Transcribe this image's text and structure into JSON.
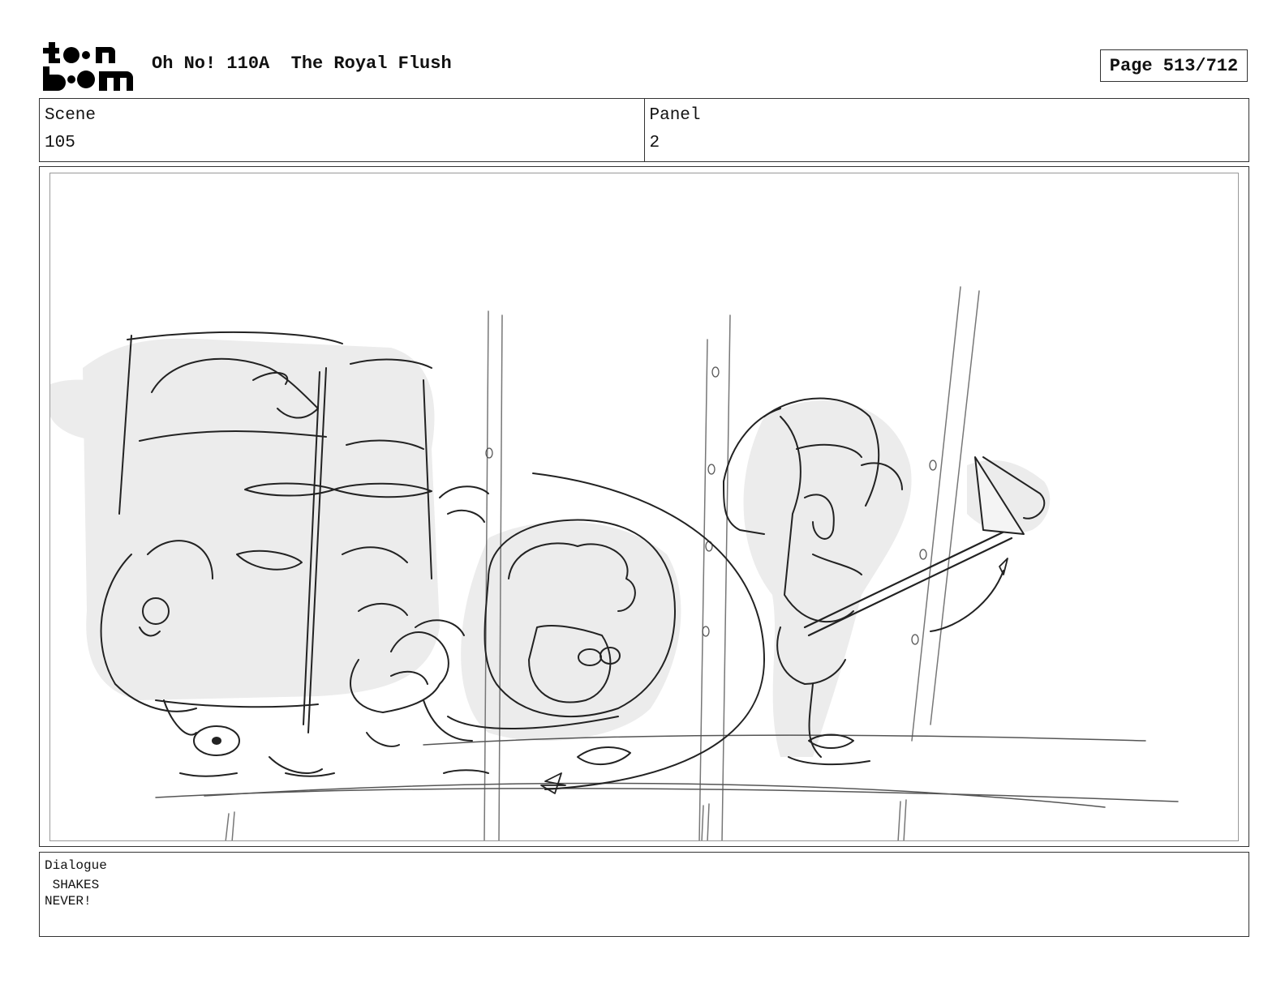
{
  "header": {
    "logo_text": "toon boom",
    "title": "Oh No! 110A  The Royal Flush",
    "page": "Page 513/712"
  },
  "info": {
    "scene_label": "Scene",
    "scene_value": "105",
    "panel_label": "Panel",
    "panel_value": "2"
  },
  "dialogue": {
    "label": "Dialogue",
    "text": " SHAKES\nNEVER!"
  }
}
